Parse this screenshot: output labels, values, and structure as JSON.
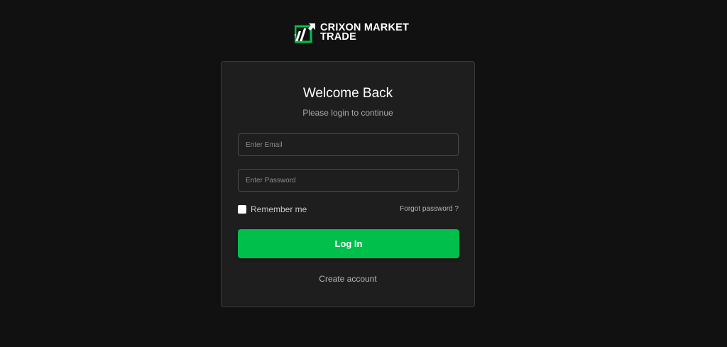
{
  "brand": {
    "name_line1": "CRIXON MARKET",
    "name_line2": "TRADE",
    "logo_icon": "rising-chart-logo-icon",
    "accent_color": "#00c04b"
  },
  "login": {
    "title": "Welcome Back",
    "subtitle": "Please login to continue",
    "email_placeholder": "Enter Email",
    "password_placeholder": "Enter Password",
    "remember_label": "Remember me",
    "remember_checked": false,
    "forgot_label": "Forgot password ?",
    "submit_label": "Log In",
    "create_account_label": "Create account"
  }
}
